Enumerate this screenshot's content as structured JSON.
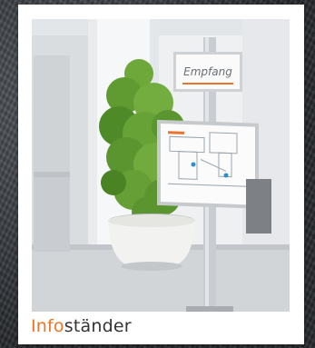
{
  "card": {
    "caption_accent": "Info",
    "caption_rest": "ständer"
  },
  "photo": {
    "sign_label": "Empfang"
  },
  "colors": {
    "accent": "#e8752a",
    "caption_text": "#333333",
    "card_bg": "#ffffff"
  }
}
